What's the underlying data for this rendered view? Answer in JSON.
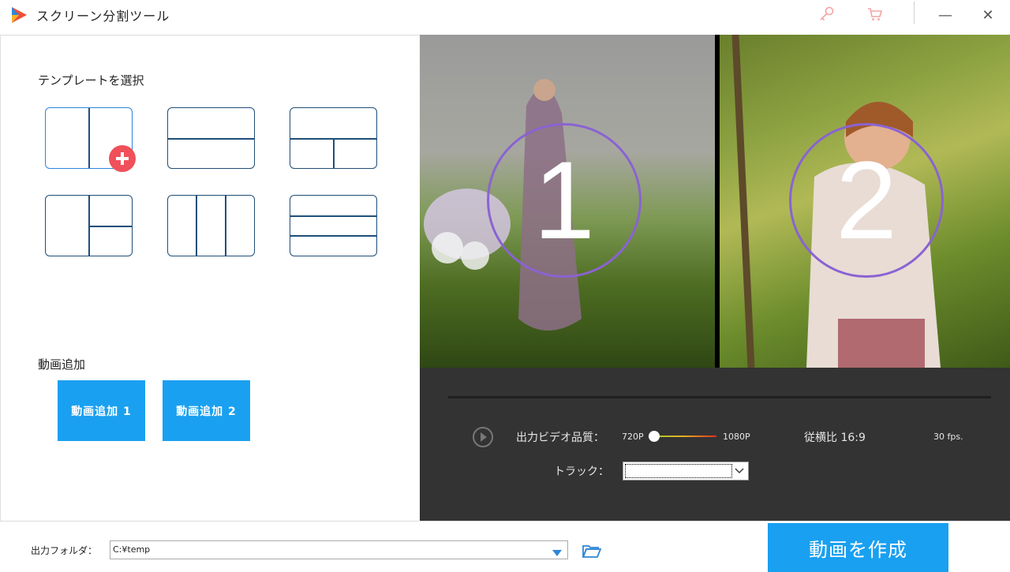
{
  "app": {
    "title": "スクリーン分割ツール",
    "icons": {
      "logo": "app-logo-icon",
      "key": "key-icon",
      "cart": "cart-icon",
      "minimize": "minimize-icon",
      "close": "close-icon"
    },
    "minimize_glyph": "—",
    "close_glyph": "✕"
  },
  "templates": {
    "heading": "テンプレートを選択",
    "items": [
      "split-vertical-2",
      "split-horizontal-2",
      "top-bottom-split-bottom",
      "left-right-split-right",
      "split-vertical-3",
      "split-horizontal-3"
    ],
    "selected_index": 0
  },
  "add_video": {
    "heading": "動画追加",
    "button1": "動画追加 1",
    "button2": "動画追加 2"
  },
  "preview": {
    "pane1_number": "1",
    "pane2_number": "2"
  },
  "controls": {
    "quality_label": "出力ビデオ品質：",
    "quality_min": "720P",
    "quality_max": "1080P",
    "quality_value": 0,
    "aspect_label": "従横比 16:9",
    "fps": "30 fps.",
    "track_label": "トラック：",
    "track_value": ""
  },
  "output": {
    "label": "出力フォルダ：",
    "path": "C:¥temp",
    "create_button": "動画を作成"
  },
  "colors": {
    "accent": "#1aa0f0",
    "template_border": "#1f4e79",
    "plus_badge": "#f0505a",
    "circle_border": "#8a63d2",
    "controls_bg": "#333333",
    "titlebar_icons": "#f5a3a3"
  }
}
